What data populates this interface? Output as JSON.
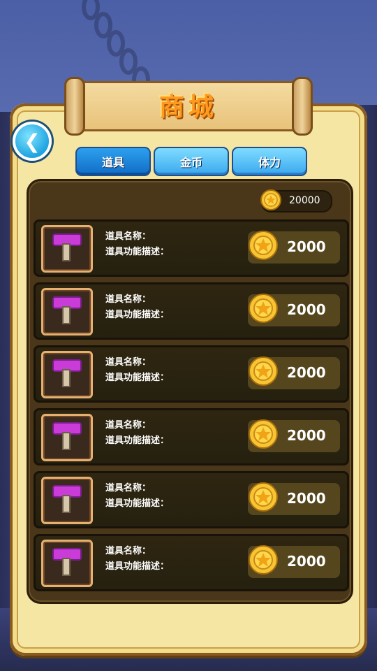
{
  "title": "商城",
  "back_icon": "back-arrow-icon",
  "tabs": [
    {
      "label": "道具",
      "active": true
    },
    {
      "label": "金币",
      "active": false
    },
    {
      "label": "体力",
      "active": false
    }
  ],
  "balance": {
    "icon": "coin-icon",
    "value": "20000"
  },
  "items": [
    {
      "icon": "hammer-icon",
      "name_label": "道具名称：",
      "desc_label": "道具功能描述：",
      "price": "2000"
    },
    {
      "icon": "hammer-icon",
      "name_label": "道具名称：",
      "desc_label": "道具功能描述：",
      "price": "2000"
    },
    {
      "icon": "hammer-icon",
      "name_label": "道具名称：",
      "desc_label": "道具功能描述：",
      "price": "2000"
    },
    {
      "icon": "hammer-icon",
      "name_label": "道具名称：",
      "desc_label": "道具功能描述：",
      "price": "2000"
    },
    {
      "icon": "hammer-icon",
      "name_label": "道具名称：",
      "desc_label": "道具功能描述：",
      "price": "2000"
    },
    {
      "icon": "hammer-icon",
      "name_label": "道具名称：",
      "desc_label": "道具功能描述：",
      "price": "2000"
    }
  ],
  "colors": {
    "accent": "#ff9a1f",
    "tab_active": "#106cc6",
    "panel": "#f6e6a4",
    "list_bg": "#4a3618"
  }
}
